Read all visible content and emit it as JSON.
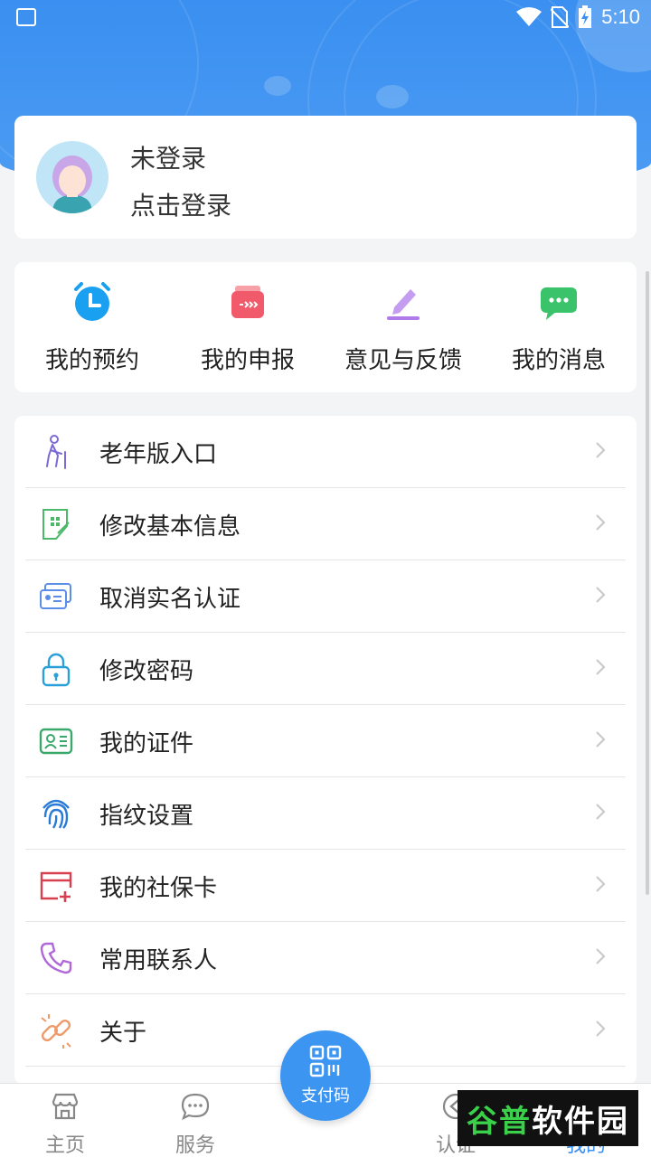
{
  "status_bar": {
    "time": "5:10"
  },
  "profile": {
    "status": "未登录",
    "hint": "点击登录"
  },
  "quick_actions": [
    {
      "label": "我的预约",
      "icon": "alarm-clock-icon",
      "color": "#1aa0f0"
    },
    {
      "label": "我的申报",
      "icon": "report-icon",
      "color": "#f05a6a"
    },
    {
      "label": "意见与反馈",
      "icon": "pencil-icon",
      "color": "#b07be8"
    },
    {
      "label": "我的消息",
      "icon": "chat-icon",
      "color": "#3ac36a"
    }
  ],
  "menu": [
    {
      "label": "老年版入口",
      "icon": "elderly-icon"
    },
    {
      "label": "修改基本信息",
      "icon": "edit-info-icon"
    },
    {
      "label": "取消实名认证",
      "icon": "id-cards-icon"
    },
    {
      "label": "修改密码",
      "icon": "lock-icon"
    },
    {
      "label": "我的证件",
      "icon": "id-card-icon"
    },
    {
      "label": "指纹设置",
      "icon": "fingerprint-icon"
    },
    {
      "label": "我的社保卡",
      "icon": "social-card-icon"
    },
    {
      "label": "常用联系人",
      "icon": "phone-contact-icon"
    },
    {
      "label": "关于",
      "icon": "link-icon"
    }
  ],
  "pay_button": {
    "label": "支付码"
  },
  "tabs": [
    {
      "label": "主页",
      "icon": "store-icon"
    },
    {
      "label": "服务",
      "icon": "chat-bubble-icon"
    },
    {
      "label": "认证",
      "icon": "verify-icon"
    },
    {
      "label": "我的",
      "icon": "user-icon"
    }
  ],
  "watermark": {
    "part1": "谷普",
    "part2": "软件园"
  },
  "colors": {
    "primary": "#3a8ff0",
    "background": "#f3f4f6"
  }
}
